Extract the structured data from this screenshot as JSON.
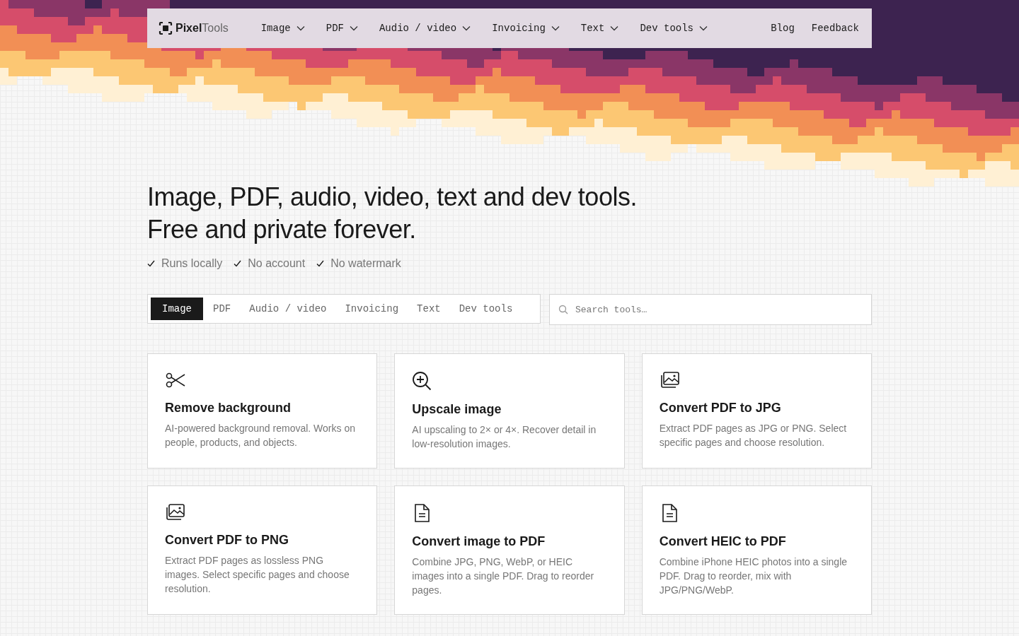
{
  "header": {
    "logo": "**Pixel**Tools",
    "menu": [
      {
        "label": "Image"
      },
      {
        "label": "PDF"
      },
      {
        "label": "Audio / video"
      },
      {
        "label": "Invoicing"
      },
      {
        "label": "Text"
      },
      {
        "label": "Dev tools"
      }
    ],
    "links": [
      "Blog",
      "Feedback"
    ]
  },
  "hero": {
    "title_lines": [
      "Image, PDF, audio, video, text and dev tools.",
      "Free and private forever."
    ],
    "features": [
      "Runs locally",
      "No account",
      "No watermark"
    ]
  },
  "tabs": [
    {
      "label": "Image",
      "selected": true
    },
    {
      "label": "PDF",
      "selected": false
    },
    {
      "label": "Audio / video",
      "selected": false
    },
    {
      "label": "Invoicing",
      "selected": false
    },
    {
      "label": "Text",
      "selected": false
    },
    {
      "label": "Dev tools",
      "selected": false
    }
  ],
  "search": {
    "placeholder": "Search tools…"
  },
  "tools": [
    {
      "kind": "scissors",
      "title": "Remove background",
      "description": "AI-powered background removal. Works on people, products, and objects."
    },
    {
      "kind": "zoom",
      "title": "Upscale image",
      "description": "AI upscaling to 2× or 4×. Recover detail in low-resolution images."
    },
    {
      "kind": "images",
      "title": "Convert PDF to JPG",
      "description": "Extract PDF pages as JPG or PNG. Select specific pages and choose resolution."
    },
    {
      "kind": "images",
      "title": "Convert PDF to PNG",
      "description": "Extract PDF pages as lossless PNG images. Select specific pages and choose resolution."
    },
    {
      "kind": "file",
      "title": "Convert image to PDF",
      "description": "Combine JPG, PNG, WebP, or HEIC images into a single PDF. Drag to reorder pages."
    },
    {
      "kind": "file",
      "title": "Convert HEIC to PDF",
      "description": "Combine iPhone HEIC photos into a single PDF. Drag to reorder, mix with JPG/PNG/WebP."
    }
  ]
}
